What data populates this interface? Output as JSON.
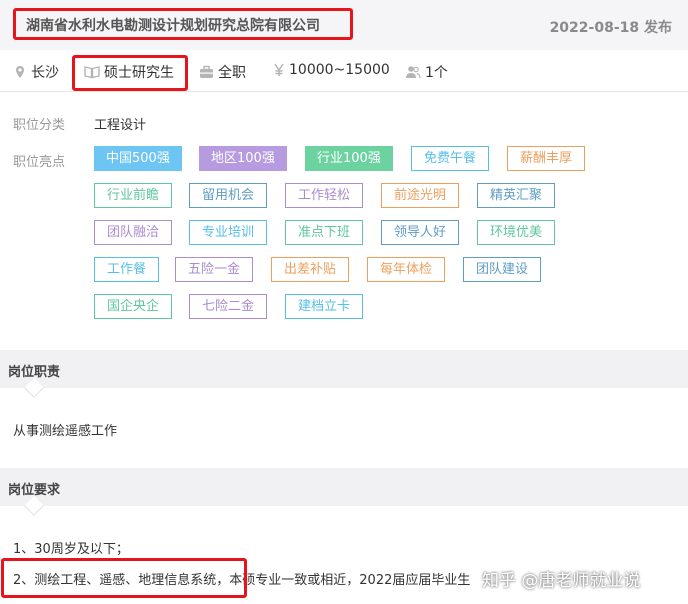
{
  "header": {
    "company": "湖南省水利水电勘测设计规划研究总院有限公司",
    "date": "2022-08-18 发布"
  },
  "meta": {
    "location": "长沙",
    "education": "硕士研究生",
    "job_type": "全职",
    "salary": "10000~15000",
    "headcount": "1个"
  },
  "category": {
    "label": "职位分类",
    "value": "工程设计"
  },
  "highlights": {
    "label": "职位亮点",
    "tags": [
      {
        "text": "中国500强",
        "style": "solid",
        "color": "#6cc5f2"
      },
      {
        "text": "地区100强",
        "style": "solid",
        "color": "#b69be0"
      },
      {
        "text": "行业100强",
        "style": "solid",
        "color": "#6cd2a0"
      },
      {
        "text": "免费午餐",
        "style": "outline",
        "color": "#56bfe7"
      },
      {
        "text": "薪酬丰厚",
        "style": "outline",
        "color": "#eda05e"
      },
      {
        "text": "行业前瞻",
        "style": "outline",
        "color": "#5ec79d"
      },
      {
        "text": "留用机会",
        "style": "outline",
        "color": "#5f9dc3"
      },
      {
        "text": "工作轻松",
        "style": "outline",
        "color": "#aa8ccf"
      },
      {
        "text": "前途光明",
        "style": "outline",
        "color": "#eda05e"
      },
      {
        "text": "精英汇聚",
        "style": "outline",
        "color": "#5f9dc3"
      },
      {
        "text": "团队融洽",
        "style": "outline",
        "color": "#aa8ccf"
      },
      {
        "text": "专业培训",
        "style": "outline",
        "color": "#56bfe7"
      },
      {
        "text": "准点下班",
        "style": "outline",
        "color": "#5ec79d"
      },
      {
        "text": "领导人好",
        "style": "outline",
        "color": "#5f9dc3"
      },
      {
        "text": "环境优美",
        "style": "outline",
        "color": "#5ec79d"
      },
      {
        "text": "工作餐",
        "style": "outline",
        "color": "#56bfe7"
      },
      {
        "text": "五险一金",
        "style": "outline",
        "color": "#aa8ccf"
      },
      {
        "text": "出差补贴",
        "style": "outline",
        "color": "#eda05e"
      },
      {
        "text": "每年体检",
        "style": "outline",
        "color": "#eda05e"
      },
      {
        "text": "团队建设",
        "style": "outline",
        "color": "#5f9dc3"
      },
      {
        "text": "国企央企",
        "style": "outline",
        "color": "#5ec79d"
      },
      {
        "text": "七险二金",
        "style": "outline",
        "color": "#aa8ccf"
      },
      {
        "text": "建档立卡",
        "style": "outline",
        "color": "#56bfe7"
      }
    ]
  },
  "duties": {
    "title": "岗位职责",
    "text": "从事测绘遥感工作"
  },
  "requirements": {
    "title": "岗位要求",
    "line1": "1、30周岁及以下；",
    "line2": "2、测绘工程、遥感、地理信息系统，本硕专业一致或相近，2022届应届毕业生"
  },
  "watermark": "知乎 @唐老师就业说",
  "colors": {
    "highlight_box": "#e8141c",
    "header_bg": "#f5f5f7",
    "section_bg": "#f1f1f3"
  }
}
